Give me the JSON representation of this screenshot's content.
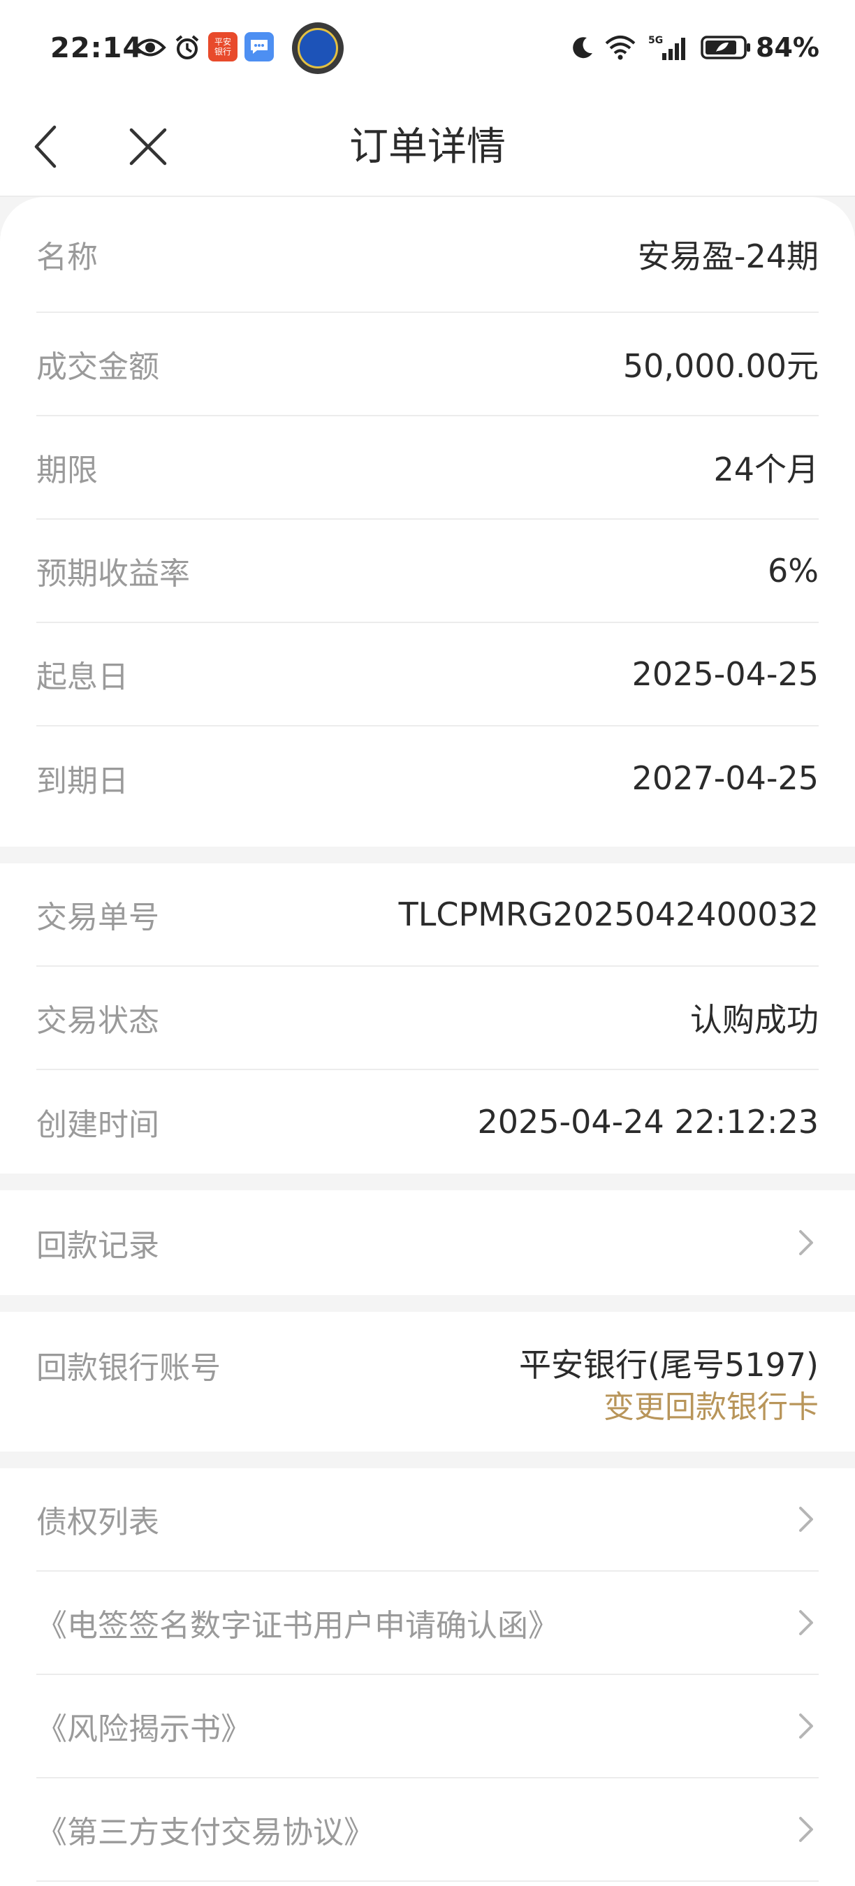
{
  "status_bar": {
    "time": "22:14",
    "bank_badge": "平安\n银行",
    "battery": "84%",
    "icons": [
      "eye-icon",
      "alarm-icon",
      "pingan-bank-app-icon",
      "message-icon",
      "avatar",
      "moon-icon",
      "wifi-icon",
      "signal-5g-icon",
      "battery-icon"
    ]
  },
  "nav": {
    "title": "订单详情",
    "back_icon": "chevron-left-icon",
    "close_icon": "close-icon"
  },
  "order": {
    "name": {
      "label": "名称",
      "value": "安易盈-24期"
    },
    "amount": {
      "label": "成交金额",
      "value": "50,000.00元"
    },
    "term": {
      "label": "期限",
      "value": "24个月"
    },
    "rate": {
      "label": "预期收益率",
      "value": "6%"
    },
    "start_date": {
      "label": "起息日",
      "value": "2025-04-25"
    },
    "end_date": {
      "label": "到期日",
      "value": "2027-04-25"
    }
  },
  "transaction": {
    "number": {
      "label": "交易单号",
      "value": "TLCPMRG2025042400032"
    },
    "status": {
      "label": "交易状态",
      "value": "认购成功"
    },
    "created": {
      "label": "创建时间",
      "value": "2025-04-24 22:12:23"
    }
  },
  "repayment": {
    "records_label": "回款记录",
    "bank_account_label": "回款银行账号",
    "bank_account_value": "平安银行(尾号5197)",
    "change_bank_label": "变更回款银行卡"
  },
  "documents": {
    "items": [
      {
        "label": "债权列表"
      },
      {
        "label": "《电签签名数字证书用户申请确认函》"
      },
      {
        "label": "《风险揭示书》"
      },
      {
        "label": "《第三方支付交易协议》"
      }
    ]
  },
  "colors": {
    "accent": "#b8955a",
    "label_gray": "#9a9a9a",
    "text_dark": "#2b2b2b",
    "background": "#f4f4f4"
  }
}
